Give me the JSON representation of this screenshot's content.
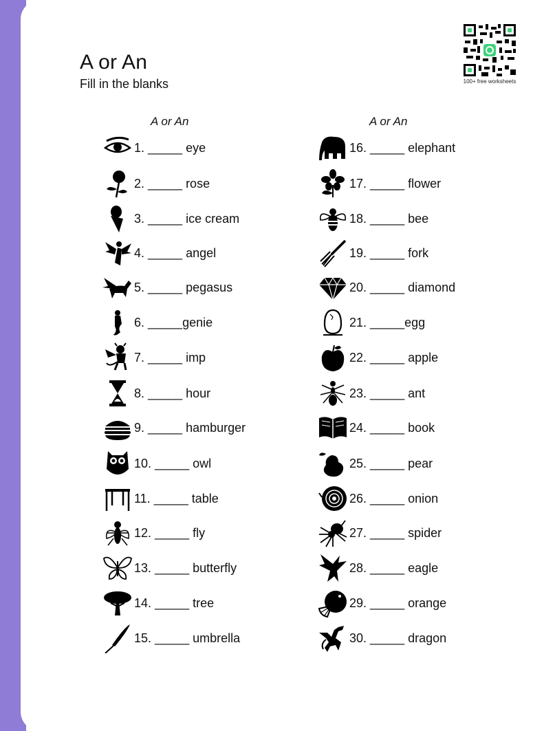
{
  "header": {
    "title": "A or An",
    "subtitle": "Fill in the blanks"
  },
  "qr": {
    "caption": "100+ free worksheets",
    "accent": "#3ed27a"
  },
  "colors": {
    "side_bar": "#8e7cd6"
  },
  "columns": [
    {
      "heading": "A or An",
      "items": [
        {
          "text": "1. _____ eye",
          "icon": "eye-icon"
        },
        {
          "text": "2. _____ rose",
          "icon": "rose-icon"
        },
        {
          "text": "3. _____ ice cream",
          "icon": "ice-cream-icon"
        },
        {
          "text": "4. _____ angel",
          "icon": "angel-icon"
        },
        {
          "text": "5. _____ pegasus",
          "icon": "pegasus-icon"
        },
        {
          "text": "6. _____genie",
          "icon": "genie-icon"
        },
        {
          "text": "7. _____ imp",
          "icon": "imp-icon"
        },
        {
          "text": "8. _____ hour",
          "icon": "hourglass-icon"
        },
        {
          "text": "9. _____ hamburger",
          "icon": "hamburger-icon"
        },
        {
          "text": "10. _____ owl",
          "icon": "owl-icon"
        },
        {
          "text": "11. _____ table",
          "icon": "table-icon"
        },
        {
          "text": "12. _____ fly",
          "icon": "fly-icon"
        },
        {
          "text": "13. _____ butterfly",
          "icon": "butterfly-icon"
        },
        {
          "text": "14. _____ tree",
          "icon": "tree-icon"
        },
        {
          "text": "15. _____ umbrella",
          "icon": "umbrella-icon"
        }
      ]
    },
    {
      "heading": "A or An",
      "items": [
        {
          "text": "16. _____ elephant",
          "icon": "elephant-icon"
        },
        {
          "text": "17. _____ flower",
          "icon": "flower-icon"
        },
        {
          "text": "18. _____ bee",
          "icon": "bee-icon"
        },
        {
          "text": "19. _____ fork",
          "icon": "fork-icon"
        },
        {
          "text": "20. _____ diamond",
          "icon": "diamond-icon"
        },
        {
          "text": "21. _____egg",
          "icon": "egg-icon"
        },
        {
          "text": "22. _____ apple",
          "icon": "apple-icon"
        },
        {
          "text": "23. _____ ant",
          "icon": "ant-icon"
        },
        {
          "text": "24. _____ book",
          "icon": "book-icon"
        },
        {
          "text": "25. _____ pear",
          "icon": "pear-icon"
        },
        {
          "text": "26. _____ onion",
          "icon": "onion-icon"
        },
        {
          "text": "27. _____ spider",
          "icon": "spider-icon"
        },
        {
          "text": "28. _____ eagle",
          "icon": "eagle-icon"
        },
        {
          "text": "29. _____ orange",
          "icon": "orange-icon"
        },
        {
          "text": "30. _____ dragon",
          "icon": "dragon-icon"
        }
      ]
    }
  ]
}
